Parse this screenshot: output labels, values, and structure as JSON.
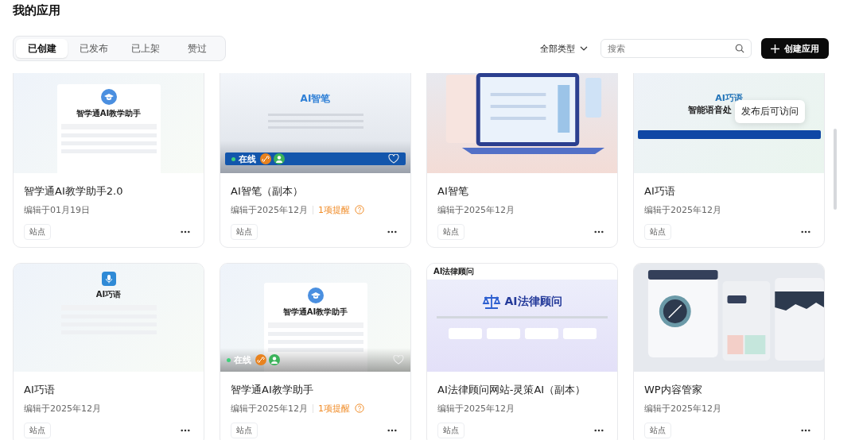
{
  "page_title": "我的应用",
  "tabs": [
    {
      "label": "已创建",
      "selected": true
    },
    {
      "label": "已发布",
      "selected": false
    },
    {
      "label": "已上架",
      "selected": false
    },
    {
      "label": "赞过",
      "selected": false
    }
  ],
  "type_filter": "全部类型",
  "search": {
    "placeholder": "搜索"
  },
  "create_button": "创建应用",
  "apps": [
    {
      "name": "智学通AI教学助手2.0",
      "edited": "编辑于01月19日",
      "tag": "站点",
      "preview": {
        "kind": "cap-login",
        "heading": "智学通AI教学助手"
      }
    },
    {
      "name": "AI智笔（副本）",
      "edited": "编辑于2025年12月",
      "reminder": "1项提醒",
      "tag": "站点",
      "status": "在线",
      "preview": {
        "kind": "blue-banner",
        "heading": "AI智笔"
      }
    },
    {
      "name": "AI智笔",
      "edited": "编辑于2025年12月",
      "tag": "站点",
      "preview": {
        "kind": "laptop"
      }
    },
    {
      "name": "AI巧语",
      "edited": "编辑于2025年12月",
      "tag": "站点",
      "tooltip": "发布后可访问",
      "preview": {
        "kind": "voice-banner",
        "heading": "AI巧语",
        "subheading": "智能语音处"
      }
    },
    {
      "name": "AI巧语",
      "edited": "编辑于2025年12月",
      "tag": "站点",
      "preview": {
        "kind": "mic-login",
        "heading": "AI巧语"
      }
    },
    {
      "name": "智学通AI教学助手",
      "edited": "编辑于2025年12月",
      "reminder": "1项提醒",
      "tag": "站点",
      "status": "在线",
      "preview": {
        "kind": "cap-login",
        "heading": "智学通AI教学助手"
      }
    },
    {
      "name": "AI法律顾问网站-灵策AI（副本）",
      "edited": "编辑于2025年12月",
      "tag": "站点",
      "preview": {
        "kind": "law-banner",
        "nav_title": "AI法律顾问",
        "heading": "AI法律顾问"
      }
    },
    {
      "name": "WP内容管家",
      "edited": "编辑于2025年12月",
      "tag": "站点",
      "preview": {
        "kind": "dashboard"
      }
    }
  ]
}
